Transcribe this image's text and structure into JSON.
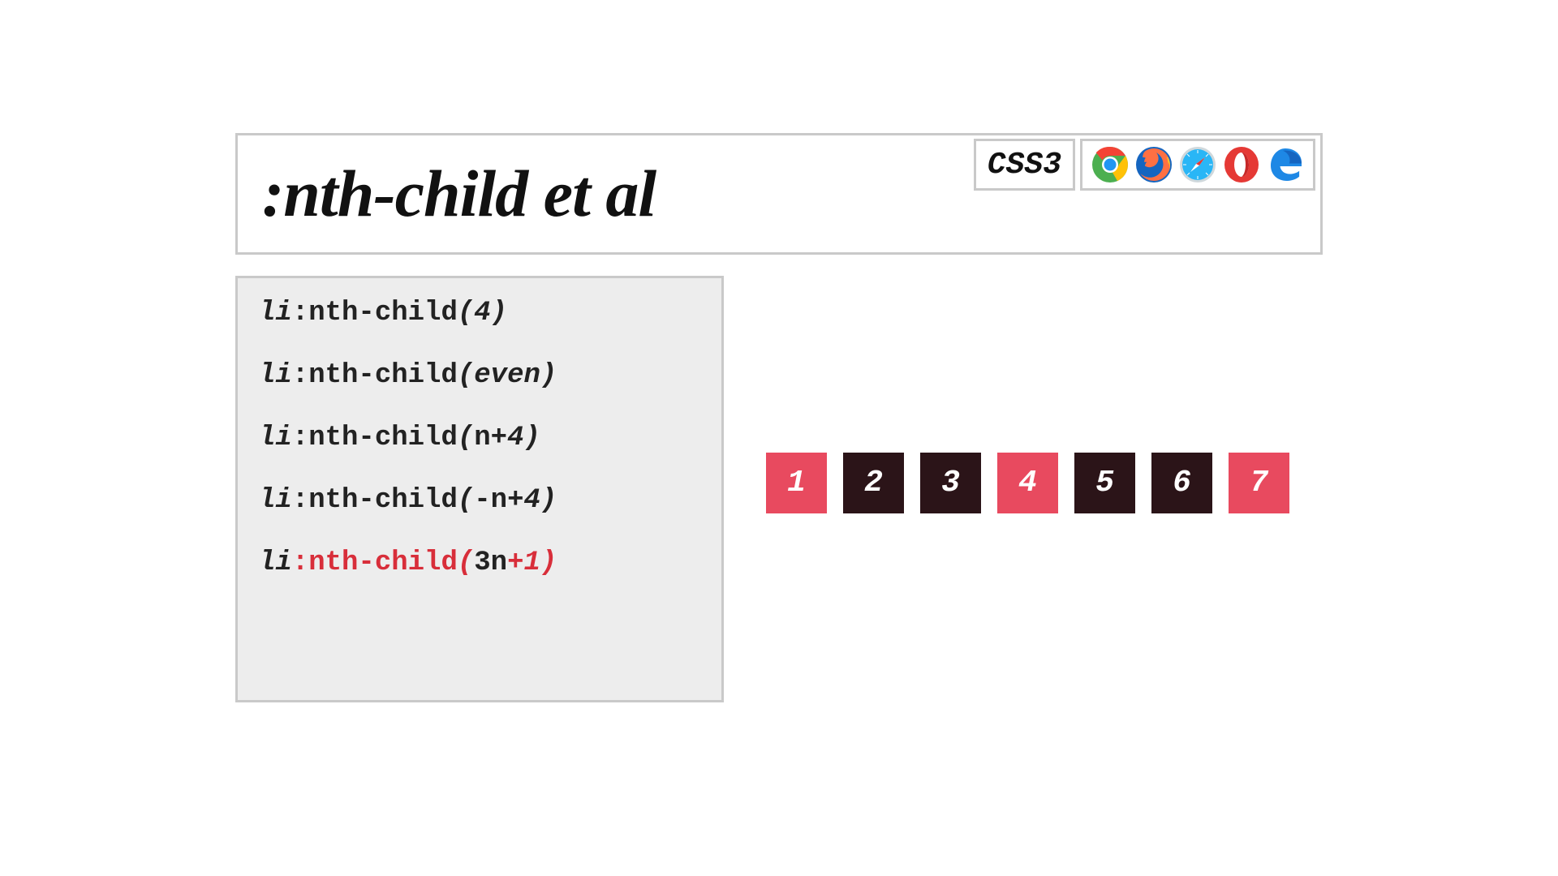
{
  "header": {
    "title": ":nth-child et al",
    "spec_badge": "CSS3",
    "browser_icons": [
      "chrome-icon",
      "firefox-icon",
      "safari-icon",
      "opera-icon",
      "edge-icon"
    ]
  },
  "code": {
    "selector_tag": "li",
    "lines": [
      {
        "pseudo": ":nth-child",
        "arg_literal": "4",
        "arg_var": "",
        "active": false
      },
      {
        "pseudo": ":nth-child",
        "arg_literal": "even",
        "arg_var": "",
        "active": false
      },
      {
        "pseudo": ":nth-child",
        "arg_literal": "+4",
        "arg_var": "n",
        "active": false
      },
      {
        "pseudo": ":nth-child",
        "arg_literal": "+4",
        "arg_var": "-n",
        "active": false
      },
      {
        "pseudo": ":nth-child",
        "arg_literal": "+1",
        "arg_var": "3n",
        "active": true
      }
    ]
  },
  "boxes": {
    "items": [
      {
        "label": "1",
        "hit": true
      },
      {
        "label": "2",
        "hit": false
      },
      {
        "label": "3",
        "hit": false
      },
      {
        "label": "4",
        "hit": true
      },
      {
        "label": "5",
        "hit": false
      },
      {
        "label": "6",
        "hit": false
      },
      {
        "label": "7",
        "hit": true
      }
    ]
  },
  "colors": {
    "box_default": "#2b1418",
    "box_selected": "#e84a5f",
    "accent": "#d82e3a"
  }
}
